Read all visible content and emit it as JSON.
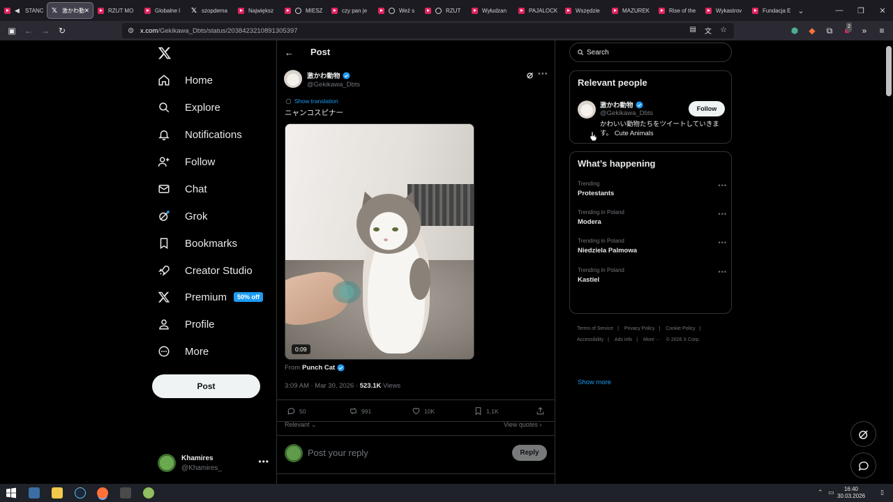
{
  "browser": {
    "tabs": [
      {
        "label": "STANC",
        "icon": "audio-icon"
      },
      {
        "label": "激かわ動",
        "icon": "x-logo-icon",
        "active": true
      },
      {
        "label": "RZUT MO",
        "icon": "youtube-icon"
      },
      {
        "label": "Globalne l",
        "icon": "youtube-icon"
      },
      {
        "label": "szopdema",
        "icon": "x-logo-icon"
      },
      {
        "label": "Największ",
        "icon": "youtube-icon"
      },
      {
        "label": "MIESZ",
        "icon": "youtube-icon"
      },
      {
        "label": "czy pan je",
        "icon": "youtube-icon"
      },
      {
        "label": "Weź s",
        "icon": "youtube-icon"
      },
      {
        "label": "RZUT",
        "icon": "youtube-icon"
      },
      {
        "label": "Wyłudzan",
        "icon": "youtube-icon"
      },
      {
        "label": "PAJALOCK",
        "icon": "youtube-icon"
      },
      {
        "label": "Wszędzie",
        "icon": "youtube-icon"
      },
      {
        "label": "MAZUREK",
        "icon": "youtube-icon"
      },
      {
        "label": "Rise of the",
        "icon": "youtube-icon"
      },
      {
        "label": "Wykastrov",
        "icon": "youtube-icon"
      },
      {
        "label": "Fundacja E",
        "icon": "youtube-icon"
      }
    ],
    "url_host": "x.com",
    "url_path": "/Gekikawa_Dbts/status/2038423210891305397",
    "extension_badge": "2"
  },
  "sidebar": {
    "logo": "x-logo-icon",
    "items": [
      {
        "label": "Home",
        "icon": "home-icon"
      },
      {
        "label": "Explore",
        "icon": "search-icon"
      },
      {
        "label": "Notifications",
        "icon": "bell-icon"
      },
      {
        "label": "Follow",
        "icon": "add-person-icon"
      },
      {
        "label": "Chat",
        "icon": "mail-icon"
      },
      {
        "label": "Grok",
        "icon": "grok-icon"
      },
      {
        "label": "Bookmarks",
        "icon": "bookmark-icon"
      },
      {
        "label": "Creator Studio",
        "icon": "rocket-icon"
      },
      {
        "label": "Premium",
        "icon": "x-logo-icon",
        "badge": "50% off"
      },
      {
        "label": "Profile",
        "icon": "person-icon"
      },
      {
        "label": "More",
        "icon": "more-circle-icon"
      }
    ],
    "post_button": "Post",
    "account": {
      "name": "Khamires",
      "handle": "@Khamires_"
    }
  },
  "post": {
    "header_title": "Post",
    "author_name": "激かわ動物",
    "author_handle": "@Gekikawa_Dbts",
    "show_translation": "Show translation",
    "text": "ニャンコスピナー",
    "video_duration": "0:09",
    "from_label": "From",
    "from_account": "Punch Cat",
    "timestamp": "3:09 AM · Mar 30, 2026 · ",
    "views_count": "523.1K",
    "views_label": " Views",
    "stats": {
      "replies": "50",
      "reposts": "991",
      "likes": "10K",
      "bookmarks": "1.1K"
    },
    "sort_label": "Relevant",
    "view_quotes": "View quotes",
    "reply_placeholder": "Post your reply",
    "reply_button": "Reply"
  },
  "right": {
    "search_placeholder": "Search",
    "relevant_title": "Relevant people",
    "person": {
      "name": "激かわ動物",
      "handle": "@Gekikawa_Dbts",
      "follow": "Follow",
      "bio": "かわいい動物たちをツイートしていきます。 Cute Animals"
    },
    "happening_title": "What’s happening",
    "trends": [
      {
        "context": "Trending",
        "name": "Protestants"
      },
      {
        "context": "Trending in Poland",
        "name": "Modera"
      },
      {
        "context": "Trending in Poland",
        "name": "Niedziela Palmowa"
      },
      {
        "context": "Trending in Poland",
        "name": "Kastiel"
      }
    ],
    "show_more": "Show more",
    "footer": [
      "Terms of Service",
      "Privacy Policy",
      "Cookie Policy",
      "Accessibility",
      "Ads info",
      "More ···",
      "© 2026 X Corp."
    ]
  },
  "taskbar": {
    "time": "16:40",
    "date": "30.03.2026"
  },
  "colors": {
    "accent": "#1d9bf0",
    "background": "#000000",
    "border": "#2f3336",
    "muted": "#71767b"
  }
}
